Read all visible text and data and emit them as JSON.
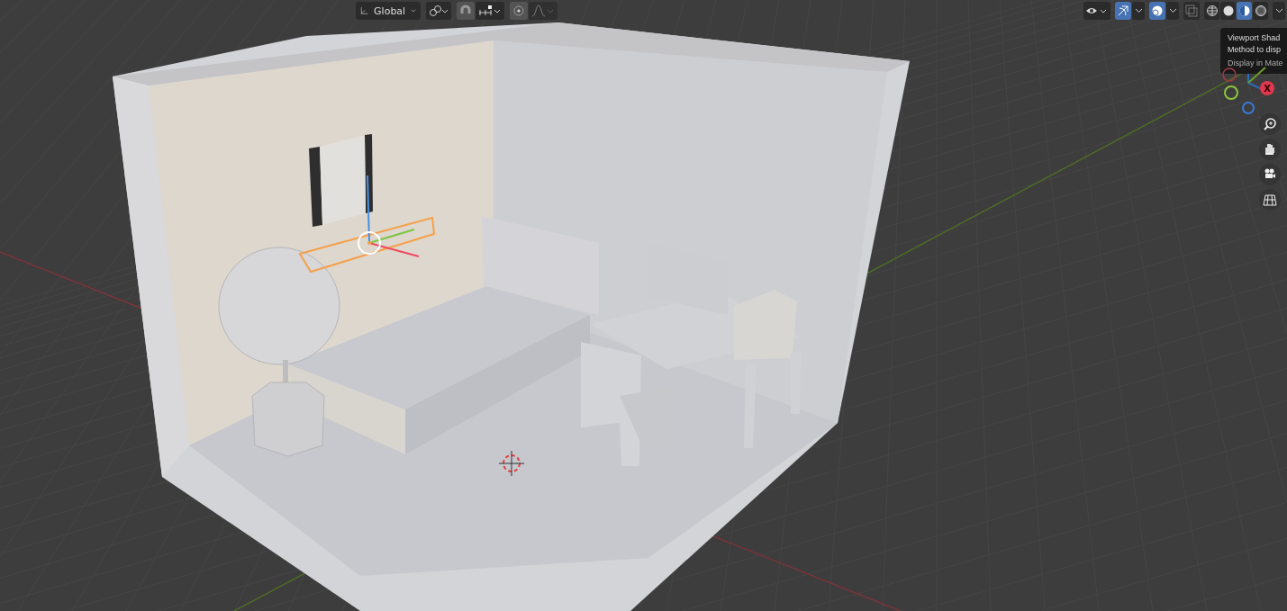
{
  "header": {
    "orientation": {
      "label": "Global"
    }
  },
  "view_controls": {
    "overlays": {
      "on": true
    },
    "xray": {
      "on": false
    },
    "shading_modes": [
      {
        "kind": "wireframe",
        "selected": false
      },
      {
        "kind": "solid",
        "selected": false
      },
      {
        "kind": "material",
        "selected": true
      },
      {
        "kind": "rendered",
        "selected": false
      }
    ]
  },
  "tooltip": {
    "lines": [
      "Viewport Shad",
      "Method to disp",
      "Display in Mate"
    ]
  },
  "gizmo": {
    "x_label": "X"
  },
  "navigation": [
    {
      "kind": "zoom"
    },
    {
      "kind": "pan"
    },
    {
      "kind": "camera"
    },
    {
      "kind": "ortho"
    }
  ]
}
